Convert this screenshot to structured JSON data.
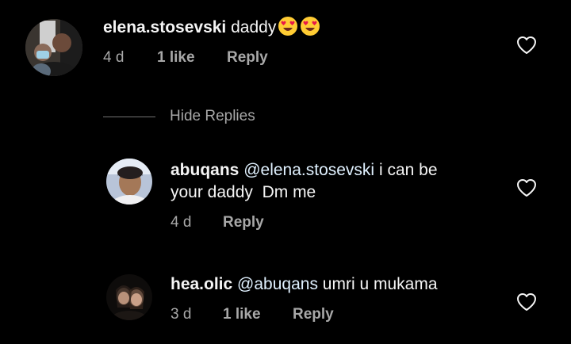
{
  "comments": [
    {
      "username": "elena.stosevski",
      "text": "daddy",
      "time": "4 d",
      "likes": "1 like",
      "reply": "Reply",
      "emojis": [
        "heart-eyes-emoji",
        "heart-eyes-emoji"
      ]
    },
    {
      "username": "abuqans",
      "mention": "@elena.stosevski",
      "text_line1": "i can be",
      "text_line2": "your daddy  Dm me",
      "time": "4 d",
      "reply": "Reply"
    },
    {
      "username": "hea.olic",
      "mention": "@abuqans",
      "text": "umri u mukama",
      "time": "3 d",
      "likes": "1 like",
      "reply": "Reply"
    }
  ],
  "hide_replies": "Hide Replies",
  "icons": {
    "like": "heart-outline-icon"
  },
  "colors": {
    "background": "#000000",
    "primary_text": "#f5f5f5",
    "secondary_text": "#a8a8a8",
    "mention": "#e0f1ff"
  }
}
